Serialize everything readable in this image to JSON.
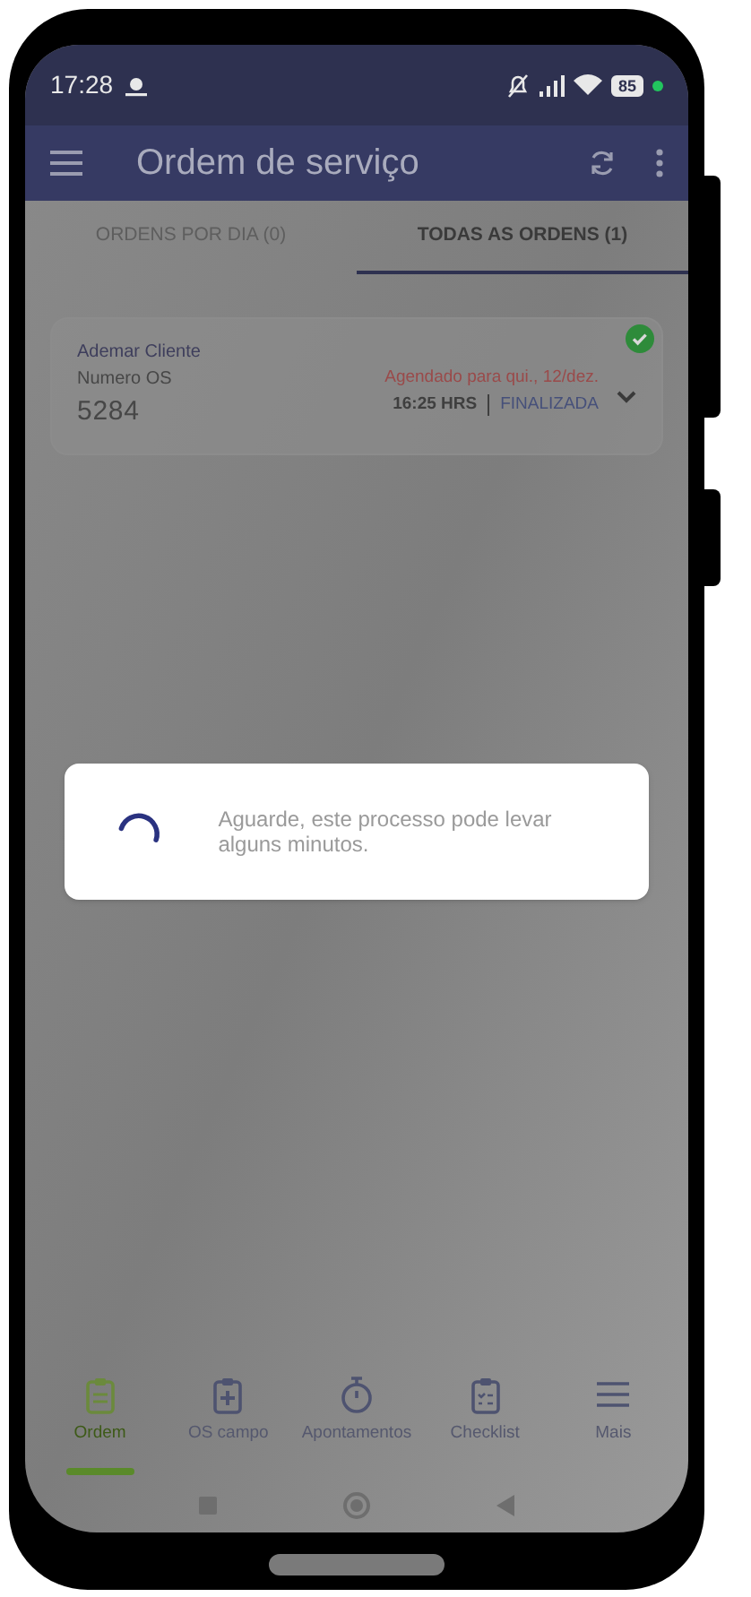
{
  "status_bar": {
    "time": "17:28",
    "battery": "85"
  },
  "app_bar": {
    "title": "Ordem de serviço"
  },
  "tabs": [
    {
      "label": "ORDENS POR DIA (0)",
      "selected": false
    },
    {
      "label": "TODAS AS ORDENS (1)",
      "selected": true
    }
  ],
  "orders": [
    {
      "client": "Ademar Cliente",
      "number_label": "Numero OS",
      "number": "5284",
      "schedule": "Agendado para qui., 12/dez.",
      "time": "16:25 HRS",
      "status": "FINALIZADA",
      "completed": true
    }
  ],
  "dialog": {
    "message": "Aguarde, este processo pode levar alguns minutos."
  },
  "bottom_nav": [
    {
      "label": "Ordem",
      "selected": true
    },
    {
      "label": "OS campo",
      "selected": false
    },
    {
      "label": "Apontamentos",
      "selected": false
    },
    {
      "label": "Checklist",
      "selected": false
    },
    {
      "label": "Mais",
      "selected": false
    }
  ]
}
